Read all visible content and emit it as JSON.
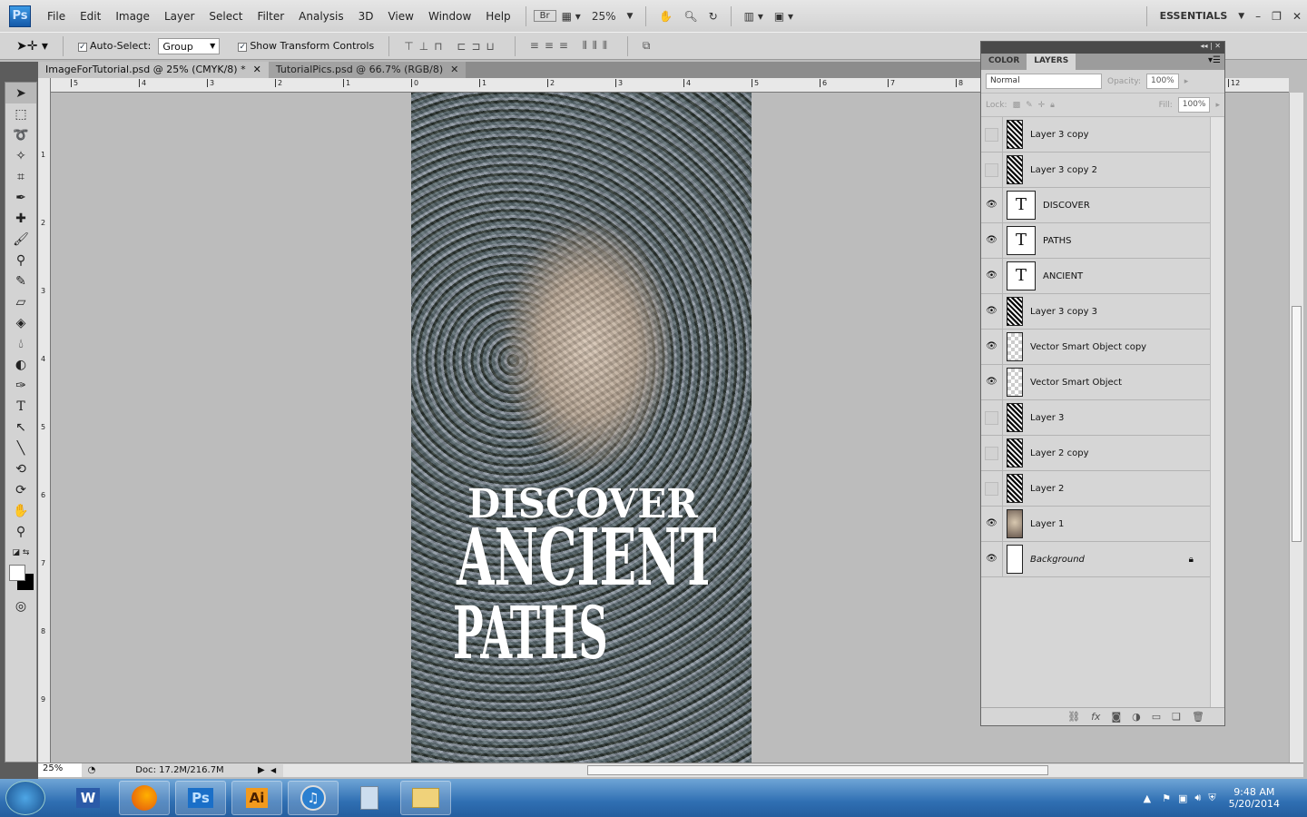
{
  "menubar": {
    "app_logo": "Ps",
    "items": [
      "File",
      "Edit",
      "Image",
      "Layer",
      "Select",
      "Filter",
      "Analysis",
      "3D",
      "View",
      "Window",
      "Help"
    ],
    "bridge": "Br",
    "zoom": "25%",
    "workspace": "ESSENTIALS"
  },
  "options": {
    "auto_select_label": "Auto-Select:",
    "auto_select_checked": true,
    "auto_select_value": "Group",
    "show_transform_label": "Show Transform Controls",
    "show_transform_checked": true
  },
  "tabs": [
    {
      "label": "ImageForTutorial.psd @ 25% (CMYK/8) *",
      "active": true
    },
    {
      "label": "TutorialPics.psd @ 66.7% (RGB/8)",
      "active": false
    }
  ],
  "rulers": {
    "h": [
      "5",
      "4",
      "3",
      "2",
      "1",
      "0",
      "1",
      "2",
      "3",
      "4",
      "5",
      "6",
      "7",
      "8",
      "12"
    ],
    "v": [
      "1",
      "2",
      "3",
      "4",
      "5",
      "6",
      "7",
      "8",
      "9"
    ]
  },
  "artwork": {
    "lines": [
      "DISCOVER",
      "ANCIENT",
      "PATHS"
    ]
  },
  "layers_panel": {
    "tabs": [
      "COLOR",
      "LAYERS"
    ],
    "active_tab": "LAYERS",
    "blend_mode": "Normal",
    "opacity_label": "Opacity:",
    "opacity": "100%",
    "lock_label": "Lock:",
    "fill_label": "Fill:",
    "fill": "100%",
    "layers": [
      {
        "name": "Layer 3 copy",
        "visible": false,
        "type": "raster"
      },
      {
        "name": "Layer 3 copy 2",
        "visible": false,
        "type": "raster"
      },
      {
        "name": "DISCOVER",
        "visible": true,
        "type": "text"
      },
      {
        "name": "PATHS",
        "visible": true,
        "type": "text"
      },
      {
        "name": "ANCIENT",
        "visible": true,
        "type": "text"
      },
      {
        "name": "Layer 3 copy 3",
        "visible": true,
        "type": "raster"
      },
      {
        "name": "Vector Smart Object copy",
        "visible": true,
        "type": "smart"
      },
      {
        "name": "Vector Smart Object",
        "visible": true,
        "type": "smart"
      },
      {
        "name": "Layer 3",
        "visible": false,
        "type": "raster"
      },
      {
        "name": "Layer 2 copy",
        "visible": false,
        "type": "raster"
      },
      {
        "name": "Layer 2",
        "visible": false,
        "type": "raster"
      },
      {
        "name": "Layer 1",
        "visible": true,
        "type": "photo"
      },
      {
        "name": "Background",
        "visible": true,
        "type": "background",
        "locked": true
      }
    ]
  },
  "status": {
    "zoom": "25%",
    "doc": "Doc: 17.2M/216.7M"
  },
  "taskbar": {
    "apps": [
      "Word",
      "Firefox",
      "Ps",
      "Ai",
      "iTunes",
      "Calculator",
      "Explorer"
    ],
    "time": "9:48 AM",
    "date": "5/20/2014"
  }
}
